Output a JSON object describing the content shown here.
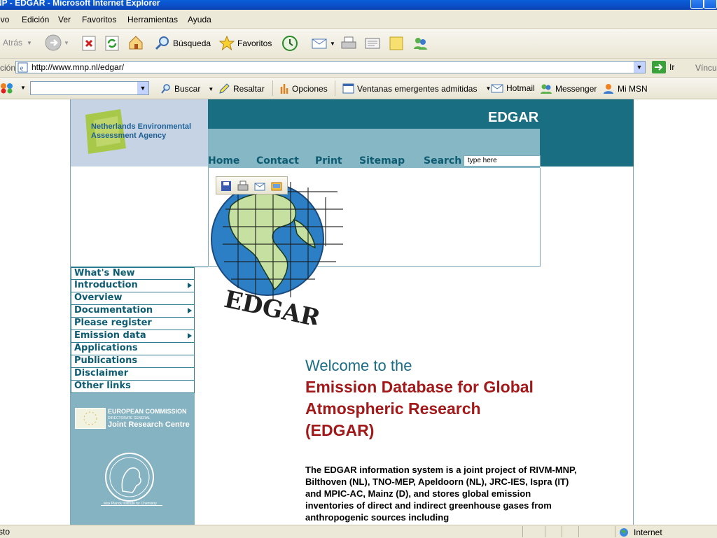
{
  "window": {
    "title": "NP - EDGAR - Microsoft Internet Explorer"
  },
  "menu": [
    "ivo",
    "Edición",
    "Ver",
    "Favoritos",
    "Herramientas",
    "Ayuda"
  ],
  "toolbar": {
    "back": "Atrás",
    "search": "Búsqueda",
    "favorites": "Favoritos"
  },
  "address": {
    "label": "ción",
    "url": "http://www.mnp.nl/edgar/",
    "go": "Ir",
    "links": "Víncul"
  },
  "msn": {
    "search_placeholder": "",
    "buscar": "Buscar",
    "resaltar": "Resaltar",
    "opciones": "Opciones",
    "popups": "Ventanas emergentes admitidas",
    "hotmail": "Hotmail",
    "messenger": "Messenger",
    "mimsn": "Mi MSN"
  },
  "site": {
    "agency": [
      "Netherlands Environmental",
      "Assessment Agency"
    ],
    "brand": "EDGAR",
    "nav": [
      "Home",
      "Contact",
      "Print",
      "Sitemap",
      "Search"
    ],
    "search_placeholder": "type here",
    "globe_label": "EDGAR",
    "sidebar": [
      {
        "label": "What's New",
        "arrow": false
      },
      {
        "label": "Introduction",
        "arrow": true
      },
      {
        "label": "Overview",
        "arrow": false
      },
      {
        "label": "Documentation",
        "arrow": true
      },
      {
        "label": "Please register",
        "arrow": false
      },
      {
        "label": "Emission data",
        "arrow": true
      },
      {
        "label": "Applications",
        "arrow": false
      },
      {
        "label": "Publications",
        "arrow": false
      },
      {
        "label": "Disclaimer",
        "arrow": false
      },
      {
        "label": "Other links",
        "arrow": false
      }
    ],
    "ec_logo": [
      "EUROPEAN COMMISSION",
      "DIRECTORATE GENERAL",
      "Joint Research Centre"
    ],
    "mpi_caption": "Max Planck Institute for Chemistry",
    "welcome_line1": "Welcome to the",
    "welcome_line2": "Emission Database for Global",
    "welcome_line3": "Atmospheric Research",
    "welcome_line4": "(EDGAR)",
    "body": "The EDGAR information system is a joint project of RIVM-MNP, Bilthoven (NL), TNO-MEP, Apeldoorn (NL), JRC-IES, Ispra (IT) and MPIC-AC, Mainz (D), and stores global emission inventories of direct and indirect greenhouse gases from anthropogenic sources including"
  },
  "status": {
    "left": "sto",
    "zone": "Internet"
  }
}
